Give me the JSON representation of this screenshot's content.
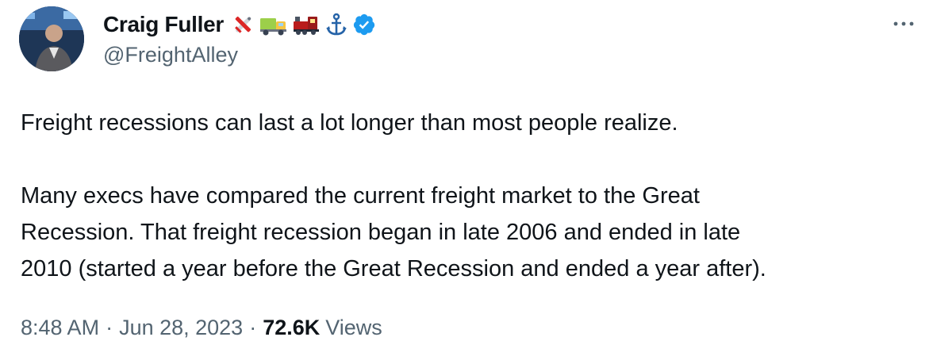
{
  "author": {
    "display_name": "Craig Fuller",
    "handle": "@FreightAlley",
    "emojis": [
      "airplane-icon",
      "truck-icon",
      "train-icon",
      "anchor-icon"
    ],
    "verified": true
  },
  "tweet": {
    "paragraph_1": "Freight recessions can last a lot longer than most people realize.",
    "paragraph_2_line_1": "Many execs have compared the current freight market to the Great",
    "paragraph_2_line_2": "Recession. That freight recession began in late 2006 and ended in late",
    "paragraph_2_line_3": "2010 (started a year before the Great Recession and ended a year after)."
  },
  "meta": {
    "time": "8:48 AM",
    "separator": "·",
    "date": "Jun 28, 2023",
    "views_count": "72.6K",
    "views_label": "Views"
  },
  "colors": {
    "text": "#0f1419",
    "secondary": "#536471",
    "verified": "#1d9bf0"
  }
}
